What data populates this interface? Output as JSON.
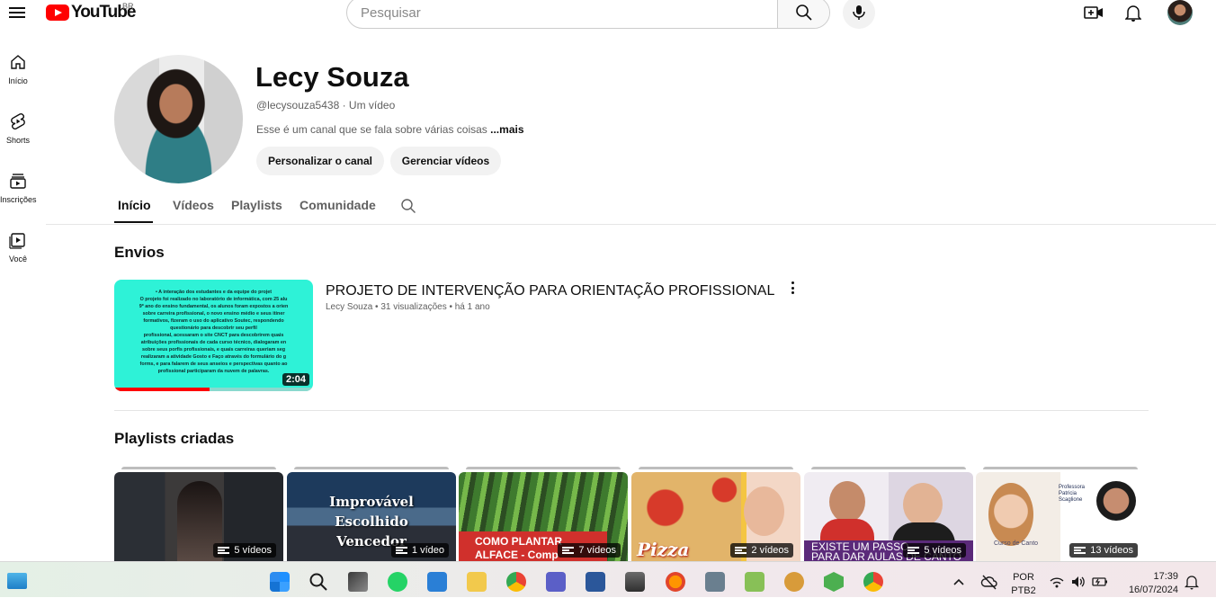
{
  "header": {
    "logo_text": "YouTube",
    "region": "BR",
    "search_placeholder": "Pesquisar"
  },
  "sidebar": {
    "items": [
      {
        "label": "Início",
        "icon": "home-icon"
      },
      {
        "label": "Shorts",
        "icon": "shorts-icon"
      },
      {
        "label": "Inscrições",
        "icon": "subscriptions-icon"
      },
      {
        "label": "Você",
        "icon": "you-icon"
      }
    ]
  },
  "channel": {
    "name": "Lecy Souza",
    "handle_meta": "@lecysouza5438 · Um vídeo",
    "description": "Esse é um canal que se fala sobre várias coisas ",
    "more": "...mais",
    "customize_label": "Personalizar o canal",
    "manage_label": "Gerenciar vídeos"
  },
  "tabs": [
    "Início",
    "Vídeos",
    "Playlists",
    "Comunidade"
  ],
  "uploads": {
    "title": "Envios",
    "video": {
      "title": "PROJETO DE INTERVENÇÃO PARA ORIENTAÇÃO PROFISSIONAL",
      "meta": "Lecy Souza • 31 visualizações • há 1 ano",
      "duration": "2:04",
      "watched_fraction": 0.48,
      "thumb_lines": [
        "• A interação dos estudantes e da equipe do projet",
        "O projeto foi realizado no laboratório de informática, com 25 alu",
        "9º ano do ensino fundamental, os alunos foram expostos a orien",
        "sobre carreira profissional, o novo ensino médio e seus itiner",
        "formativos, fizeram o uso do aplicativo Soutec, respondendo",
        "questionário para descobrir seu perfil",
        "profissional, acessaram o site CNCT para descobrirem quais",
        "atribuições profissionais de cada curso técnico, dialogaram en",
        "sobre seus porfis profissionais, e quais carreiras queriam seg",
        "realizaram a atividade Gosto e Faço através do formulário do g",
        "forms, e para falarem de seus anseios e perspectivas quanto ao",
        "profissional participaram da nuvem de palavras."
      ]
    }
  },
  "playlists": {
    "title": "Playlists criadas",
    "items": [
      {
        "count": "5 vídeos"
      },
      {
        "count": "1 vídeo",
        "caption_lines": [
          "Improvável",
          "Escolhido",
          "Vencedor"
        ]
      },
      {
        "count": "7 vídeos",
        "caption_lines": [
          "COMO PLANTAR",
          "ALFACE - Comp"
        ]
      },
      {
        "count": "2 vídeos",
        "caption_lines": [
          "Pizza"
        ]
      },
      {
        "count": "5 vídeos",
        "caption_lines": [
          "EXISTE UM PASSO",
          "PARA DAR AULAS DE CANTO"
        ]
      },
      {
        "count": "13 vídeos",
        "caption_lines": [
          "Professora",
          "Patricia",
          "Scaglione",
          "Curso de Canto"
        ]
      }
    ]
  },
  "taskbar": {
    "lang1": "POR",
    "lang2": "PTB2",
    "time": "17:39",
    "date": "16/07/2024"
  }
}
